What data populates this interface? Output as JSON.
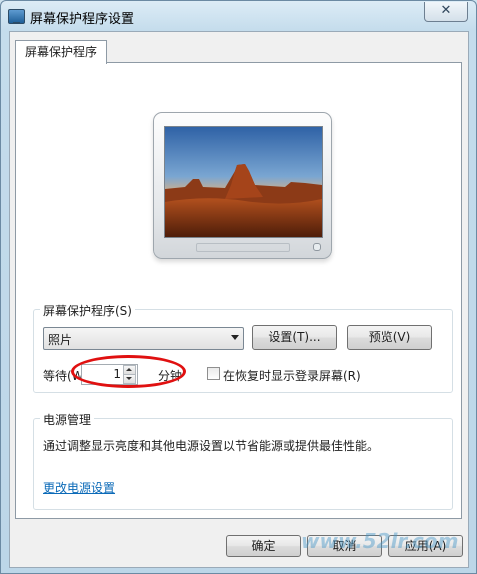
{
  "window": {
    "title": "屏幕保护程序设置",
    "close_glyph": "✕",
    "app_icon": "monitor-icon"
  },
  "tabs": [
    {
      "label": "屏幕保护程序"
    }
  ],
  "screensaver": {
    "group_title": "屏幕保护程序(S)",
    "selected": "照片",
    "settings_button": "设置(T)...",
    "preview_button": "预览(V)",
    "wait_label": "等待(W):",
    "wait_value": "1",
    "minutes_label": "分钟",
    "resume_checkbox_label": "在恢复时显示登录屏幕(R)",
    "resume_checked": false
  },
  "power": {
    "group_title": "电源管理",
    "description": "通过调整显示亮度和其他电源设置以节省能源或提供最佳性能。",
    "link": "更改电源设置"
  },
  "footer": {
    "ok": "确定",
    "cancel": "取消",
    "apply": "应用(A)"
  },
  "annotation": {
    "color": "#e01010"
  },
  "watermark": {
    "text": "www.52lr.com"
  }
}
